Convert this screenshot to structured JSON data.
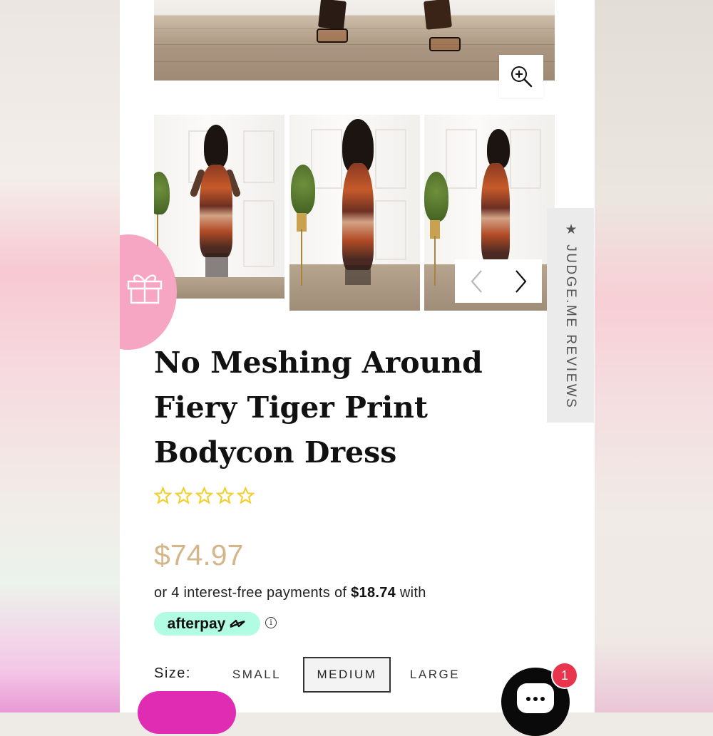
{
  "product": {
    "title": "No Meshing Around Fiery Tiger Print Bodycon Dress",
    "rating_stars": 5,
    "rating_filled": 0,
    "price": "$74.97"
  },
  "afterpay": {
    "line_prefix": "or 4 interest-free payments of ",
    "installment": "$18.74",
    "line_suffix": " with",
    "badge_label": "afterpay",
    "info_symbol": "i"
  },
  "size": {
    "label": "Size:",
    "options": [
      "SMALL",
      "MEDIUM",
      "LARGE"
    ],
    "selected": "MEDIUM"
  },
  "reviews_tab": {
    "label": "★ JUDGE.ME REVIEWS"
  },
  "chat": {
    "badge_count": "1"
  },
  "colors": {
    "price": "#d3b78a",
    "star_outline": "#f2cf2a",
    "afterpay_mint": "#b2fce4",
    "gift_pink": "#f6a6c2",
    "chat_badge": "#e8344c",
    "promo_pill": "#e02bb3"
  },
  "icons": {
    "zoom": "zoom-in-icon",
    "prev": "chevron-left-icon",
    "next": "chevron-right-icon",
    "gift": "gift-icon",
    "chat": "chat-icon"
  }
}
